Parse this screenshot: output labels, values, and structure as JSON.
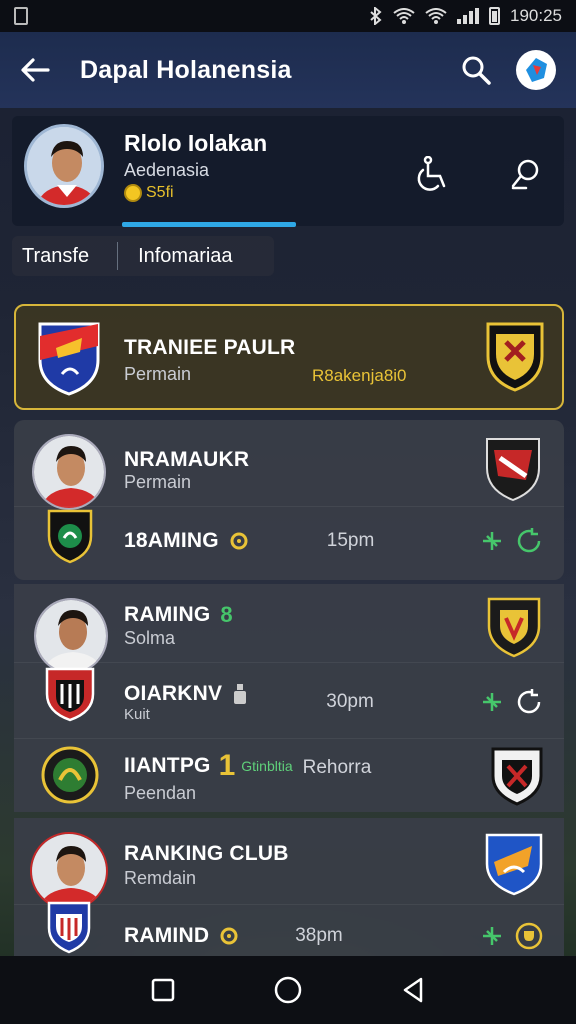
{
  "status": {
    "time": "190:25"
  },
  "appbar": {
    "title": "Dapal Holanensia"
  },
  "profile": {
    "name": "Rlolo Iolakan",
    "subtitle": "Aedenasia",
    "coins": "S5fi"
  },
  "tabs": [
    {
      "label": "Transfe"
    },
    {
      "label": "Infomariaa"
    }
  ],
  "rows": [
    {
      "title": "TRANIEE PAULR",
      "sub": "Permain",
      "extra": "R8akenja8i0"
    },
    {
      "title": "NRAMAUKR",
      "sub": "Permain"
    },
    {
      "title": "18AMING",
      "time": "15pm"
    },
    {
      "title": "RAMING",
      "badge": "8",
      "sub": "Solma"
    },
    {
      "title": "OIARKNV",
      "sub": "Kuit",
      "time": "30pm"
    },
    {
      "title": "IIANTPG",
      "badge": "1",
      "green": "Gtinbltia",
      "time": "Rehorra",
      "sub": "Peendan"
    },
    {
      "title": "RANKING CLUB",
      "sub": "Remdain"
    },
    {
      "title": "RAMIND",
      "time": "38pm"
    }
  ],
  "colors": {
    "accent": "#2fa8e6",
    "highlight_border": "#d7b63a",
    "coin": "#f3c622",
    "status_green": "#5fd07a"
  }
}
